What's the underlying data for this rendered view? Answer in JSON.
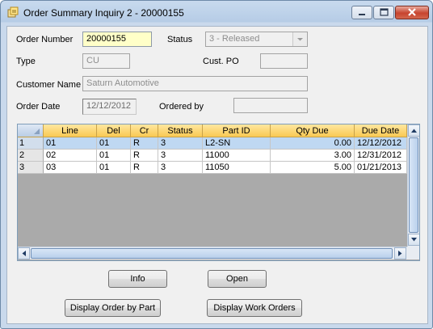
{
  "window": {
    "title": "Order Summary Inquiry 2 - 20000155",
    "icon": "app-icon",
    "controls": [
      "minimize-icon",
      "maximize-icon",
      "close-icon"
    ]
  },
  "form": {
    "order_number_label": "Order Number",
    "order_number_value": "20000155",
    "status_label": "Status",
    "status_value": "3 - Released",
    "type_label": "Type",
    "type_value": "CU",
    "cust_po_label": "Cust. PO",
    "cust_po_value": "",
    "customer_name_label": "Customer Name",
    "customer_name_value": "Saturn Automotive",
    "order_date_label": "Order Date",
    "order_date_value": "12/12/2012",
    "ordered_by_label": "Ordered by",
    "ordered_by_value": ""
  },
  "grid": {
    "columns": [
      "Line",
      "Del",
      "Cr",
      "Status",
      "Part ID",
      "Qty Due",
      "Due Date"
    ],
    "rows": [
      {
        "num": "1",
        "line": "01",
        "del": "01",
        "cr": "R",
        "status": "3",
        "part_id": "L2-SN",
        "qty_due": "0.00",
        "due_date": "12/12/2012"
      },
      {
        "num": "2",
        "line": "02",
        "del": "01",
        "cr": "R",
        "status": "3",
        "part_id": "11000",
        "qty_due": "3.00",
        "due_date": "12/31/2012"
      },
      {
        "num": "3",
        "line": "03",
        "del": "01",
        "cr": "R",
        "status": "3",
        "part_id": "11050",
        "qty_due": "5.00",
        "due_date": "01/21/2013"
      }
    ],
    "selected_row": "1"
  },
  "buttons": {
    "info": "Info",
    "open": "Open",
    "display_order_by_part": "Display Order by Part",
    "display_work_orders": "Display Work Orders"
  },
  "colors": {
    "title_bar": "#b6cce6",
    "active_field": "#ffffc8",
    "grid_header": "#f9c74e",
    "selected_row": "#bfd8f2",
    "close_button": "#c7442e"
  }
}
